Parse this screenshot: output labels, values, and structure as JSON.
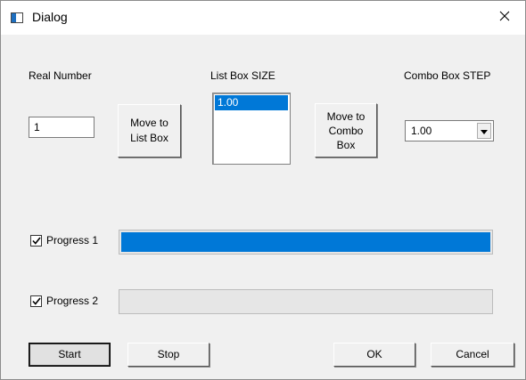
{
  "window": {
    "title": "Dialog"
  },
  "icons": {
    "app": "dialog-app-icon",
    "close": "close-icon",
    "dropdown": "dropdown-arrow-icon",
    "check": "check-icon"
  },
  "real_number": {
    "label": "Real Number",
    "value": "1"
  },
  "move_to_list_box": {
    "label_line1": "Move to",
    "label_line2": "List Box"
  },
  "list_box": {
    "label": "List Box SIZE",
    "items": [
      "1.00"
    ],
    "selected_index": 0
  },
  "move_to_combo_box": {
    "label_line1": "Move to",
    "label_line2": "Combo",
    "label_line3": "Box"
  },
  "combo_box": {
    "label": "Combo Box STEP",
    "value": "1.00"
  },
  "progress1": {
    "checkbox_label": "Progress 1",
    "checked": true,
    "fraction": 1.0,
    "color": "#0078d7"
  },
  "progress2": {
    "checkbox_label": "Progress 2",
    "checked": true,
    "fraction": 0.0
  },
  "buttons": {
    "start": "Start",
    "stop": "Stop",
    "ok": "OK",
    "cancel": "Cancel"
  },
  "colors": {
    "selection": "#0078d7",
    "dialog_bg": "#f0f0f0"
  }
}
